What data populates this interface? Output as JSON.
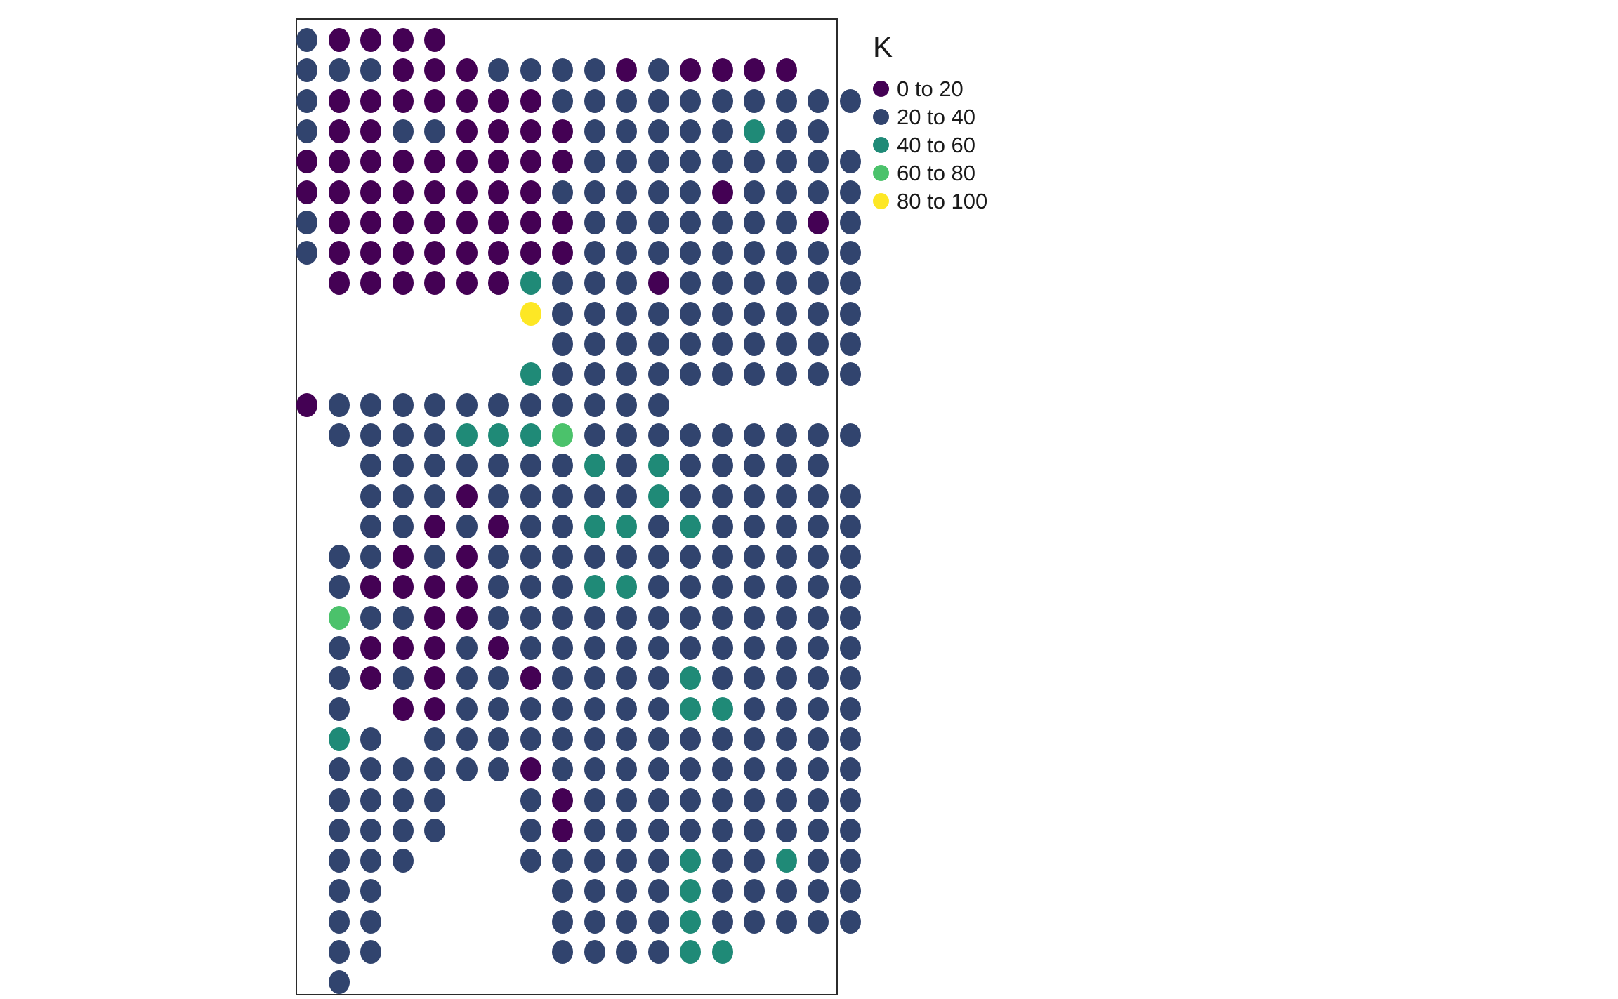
{
  "figure": {
    "background_color": "#ffffff",
    "panel_border_color": "#2b2b2b"
  },
  "legend": {
    "title": "K",
    "position": "right",
    "items": [
      {
        "label": "0 to 20",
        "color": "#440154"
      },
      {
        "label": "20 to 40",
        "color": "#31446E"
      },
      {
        "label": "40 to 60",
        "color": "#1F8A77"
      },
      {
        "label": "60 to 80",
        "color": "#4BC26B"
      },
      {
        "label": "80 to 100",
        "color": "#FDE725"
      }
    ]
  },
  "chart_data": {
    "type": "heatmap",
    "title": "",
    "subtitle": "",
    "xlabel": "",
    "ylabel": "",
    "grid": false,
    "legend_position": "right",
    "legend_title": "K",
    "marker": "circle",
    "value_bins": [
      {
        "name": "0 to 20",
        "min": 0,
        "max": 20,
        "color": "#440154"
      },
      {
        "name": "20 to 40",
        "min": 20,
        "max": 40,
        "color": "#31446E"
      },
      {
        "name": "40 to 60",
        "min": 40,
        "max": 60,
        "color": "#1F8A77"
      },
      {
        "name": "60 to 80",
        "min": 60,
        "max": 80,
        "color": "#4BC26B"
      },
      {
        "name": "80 to 100",
        "min": 80,
        "max": 100,
        "color": "#FDE725"
      }
    ],
    "grid_columns": 18,
    "grid_rows": 31,
    "x_origin": 14,
    "y_origin": 29,
    "x_step": 45.5,
    "y_step": 43.3,
    "xlim": [
      0,
      18
    ],
    "ylim": [
      0,
      31
    ],
    "bin_index_legend": {
      "0": "0 to 20",
      "1": "20 to 40",
      "2": "40 to 60",
      "3": "60 to 80",
      "4": "80 to 100"
    },
    "null_value": null,
    "rows": [
      [
        1,
        0,
        0,
        0,
        0,
        null,
        null,
        null,
        null,
        null,
        null,
        null,
        null,
        null,
        null,
        null,
        null,
        null
      ],
      [
        1,
        1,
        1,
        0,
        0,
        0,
        1,
        1,
        1,
        1,
        0,
        1,
        0,
        0,
        0,
        0,
        null,
        null
      ],
      [
        1,
        0,
        0,
        0,
        0,
        0,
        0,
        0,
        1,
        1,
        1,
        1,
        1,
        1,
        1,
        1,
        1,
        1
      ],
      [
        1,
        0,
        0,
        1,
        1,
        0,
        0,
        0,
        0,
        1,
        1,
        1,
        1,
        1,
        2,
        1,
        1,
        null
      ],
      [
        0,
        0,
        0,
        0,
        0,
        0,
        0,
        0,
        0,
        1,
        1,
        1,
        1,
        1,
        1,
        1,
        1,
        1
      ],
      [
        0,
        0,
        0,
        0,
        0,
        0,
        0,
        0,
        1,
        1,
        1,
        1,
        1,
        0,
        1,
        1,
        1,
        1
      ],
      [
        1,
        0,
        0,
        0,
        0,
        0,
        0,
        0,
        0,
        1,
        1,
        1,
        1,
        1,
        1,
        1,
        0,
        1
      ],
      [
        1,
        0,
        0,
        0,
        0,
        0,
        0,
        0,
        0,
        1,
        1,
        1,
        1,
        1,
        1,
        1,
        1,
        1
      ],
      [
        null,
        0,
        0,
        0,
        0,
        0,
        0,
        2,
        1,
        1,
        1,
        0,
        1,
        1,
        1,
        1,
        1,
        1
      ],
      [
        null,
        null,
        null,
        null,
        null,
        null,
        null,
        4,
        1,
        1,
        1,
        1,
        1,
        1,
        1,
        1,
        1,
        1
      ],
      [
        null,
        null,
        null,
        null,
        null,
        null,
        null,
        null,
        1,
        1,
        1,
        1,
        1,
        1,
        1,
        1,
        1,
        1
      ],
      [
        null,
        null,
        null,
        null,
        null,
        null,
        null,
        2,
        1,
        1,
        1,
        1,
        1,
        1,
        1,
        1,
        1,
        1
      ],
      [
        0,
        1,
        1,
        1,
        1,
        1,
        1,
        1,
        1,
        1,
        1,
        1,
        null,
        null,
        null,
        null,
        null,
        null
      ],
      [
        null,
        1,
        1,
        1,
        1,
        2,
        2,
        2,
        3,
        1,
        1,
        1,
        1,
        1,
        1,
        1,
        1,
        1
      ],
      [
        null,
        null,
        1,
        1,
        1,
        1,
        1,
        1,
        1,
        2,
        1,
        2,
        1,
        1,
        1,
        1,
        1,
        null
      ],
      [
        null,
        null,
        1,
        1,
        1,
        0,
        1,
        1,
        1,
        1,
        1,
        2,
        1,
        1,
        1,
        1,
        1,
        1
      ],
      [
        null,
        null,
        1,
        1,
        0,
        1,
        0,
        1,
        1,
        2,
        2,
        1,
        2,
        1,
        1,
        1,
        1,
        1
      ],
      [
        null,
        1,
        1,
        0,
        1,
        0,
        1,
        1,
        1,
        1,
        1,
        1,
        1,
        1,
        1,
        1,
        1,
        1
      ],
      [
        null,
        1,
        0,
        0,
        0,
        0,
        1,
        1,
        1,
        2,
        2,
        1,
        1,
        1,
        1,
        1,
        1,
        1
      ],
      [
        null,
        3,
        1,
        1,
        0,
        0,
        1,
        1,
        1,
        1,
        1,
        1,
        1,
        1,
        1,
        1,
        1,
        1
      ],
      [
        null,
        1,
        0,
        0,
        0,
        1,
        0,
        1,
        1,
        1,
        1,
        1,
        1,
        1,
        1,
        1,
        1,
        1
      ],
      [
        null,
        1,
        0,
        1,
        0,
        1,
        1,
        0,
        1,
        1,
        1,
        1,
        2,
        1,
        1,
        1,
        1,
        1
      ],
      [
        null,
        1,
        null,
        0,
        0,
        1,
        1,
        1,
        1,
        1,
        1,
        1,
        2,
        2,
        1,
        1,
        1,
        1
      ],
      [
        null,
        2,
        1,
        null,
        1,
        1,
        1,
        1,
        1,
        1,
        1,
        1,
        1,
        1,
        1,
        1,
        1,
        1
      ],
      [
        null,
        1,
        1,
        1,
        1,
        1,
        1,
        0,
        1,
        1,
        1,
        1,
        1,
        1,
        1,
        1,
        1,
        1
      ],
      [
        null,
        1,
        1,
        1,
        1,
        null,
        null,
        1,
        0,
        1,
        1,
        1,
        1,
        1,
        1,
        1,
        1,
        1
      ],
      [
        null,
        1,
        1,
        1,
        1,
        null,
        null,
        1,
        0,
        1,
        1,
        1,
        1,
        1,
        1,
        1,
        1,
        1
      ],
      [
        null,
        1,
        1,
        1,
        null,
        null,
        null,
        1,
        1,
        1,
        1,
        1,
        2,
        1,
        1,
        2,
        1,
        1
      ],
      [
        null,
        1,
        1,
        null,
        null,
        null,
        null,
        null,
        1,
        1,
        1,
        1,
        2,
        1,
        1,
        1,
        1,
        1
      ],
      [
        null,
        1,
        1,
        null,
        null,
        null,
        null,
        null,
        1,
        1,
        1,
        1,
        2,
        1,
        1,
        1,
        1,
        1
      ],
      [
        null,
        1,
        1,
        null,
        null,
        null,
        null,
        null,
        1,
        1,
        1,
        1,
        2,
        2,
        null,
        null,
        null,
        null
      ],
      [
        null,
        1,
        null,
        null,
        null,
        null,
        null,
        null,
        null,
        null,
        null,
        null,
        null,
        null,
        null,
        null,
        null,
        null
      ]
    ]
  }
}
